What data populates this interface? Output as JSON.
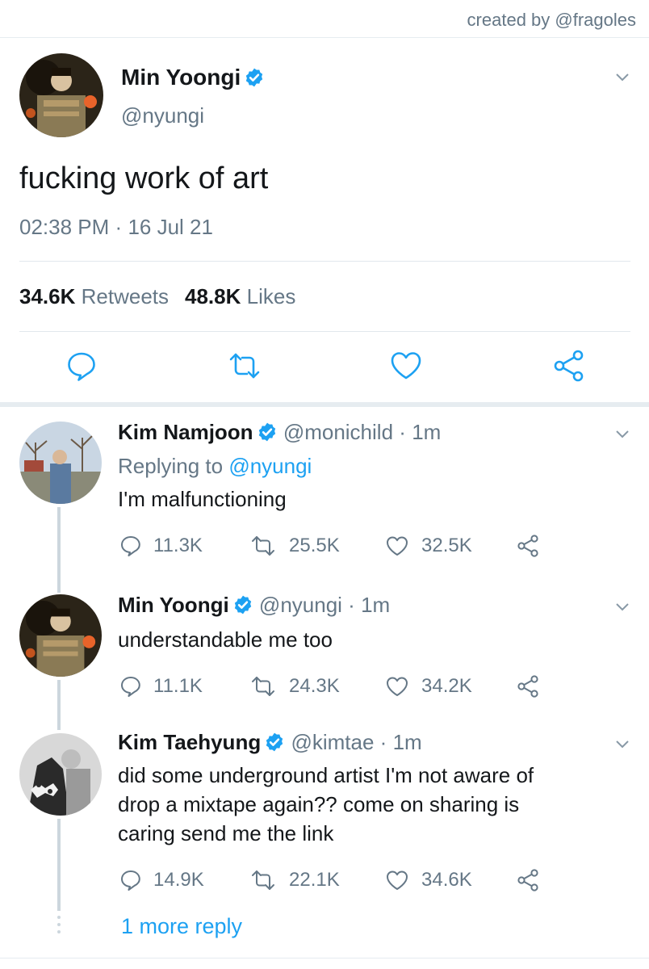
{
  "credit": "created by @fragoles",
  "colors": {
    "accent": "#1da1f2",
    "secondary_text": "#657786",
    "verified": "#1da1f2"
  },
  "main_tweet": {
    "name": "Min Yoongi",
    "handle": "@nyungi",
    "verified": true,
    "text": "fucking work of art",
    "time": "02:38 PM",
    "date_sep": "·",
    "date": "16 Jul 21",
    "retweets_count": "34.6K",
    "retweets_label": "Retweets",
    "likes_count": "48.8K",
    "likes_label": "Likes",
    "icons": [
      "reply-icon",
      "retweet-icon",
      "like-icon",
      "share-icon"
    ]
  },
  "replies": [
    {
      "name": "Kim Namjoon",
      "handle": "@monichild",
      "sep": "·",
      "time": "1m",
      "replying_prefix": "Replying to",
      "replying_handle": "@nyungi",
      "text": "I'm malfunctioning",
      "replies": "11.3K",
      "retweets": "25.5K",
      "likes": "32.5K"
    },
    {
      "name": "Min Yoongi",
      "handle": "@nyungi",
      "sep": "·",
      "time": "1m",
      "text": "understandable me too",
      "replies": "11.1K",
      "retweets": "24.3K",
      "likes": "34.2K"
    },
    {
      "name": "Kim Taehyung",
      "handle": "@kimtae",
      "sep": "·",
      "time": "1m",
      "text_lines": [
        "did some underground artist I'm not aware of",
        "drop a mixtape again?? come on sharing is",
        "caring send me the link"
      ],
      "replies": "14.9K",
      "retweets": "22.1K",
      "likes": "34.6K"
    }
  ],
  "more_replies": "1 more reply"
}
